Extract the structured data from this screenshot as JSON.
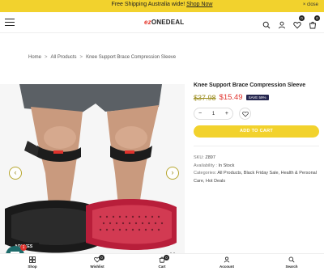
{
  "announcement": {
    "text": "Free Shipping Australia wide! ",
    "link": "Shop Now",
    "close": "× close"
  },
  "header": {
    "logo_part1": "ez",
    "logo_part2": "ONEDEAL",
    "wishlist_count": "0",
    "cart_count": "0"
  },
  "breadcrumb": {
    "home": "Home",
    "all_products": "All Products",
    "current": "Knee Support Brace Compression Sleeve"
  },
  "gallery": {
    "prev": "‹",
    "next": "›",
    "strap_brand": "AOLIKES"
  },
  "product": {
    "title": "Knee Support Brace Compression Sleeve",
    "old_price": "$37.98",
    "new_price": "$15.49",
    "save_badge": "SAVE 59%",
    "quantity": "1",
    "minus": "−",
    "plus": "+",
    "add_to_cart": "ADD TO CART",
    "sku_label": "SKU:",
    "sku": "Z897",
    "availability_label": "Availability :",
    "availability": "In Stock",
    "categories_label": "Categories:",
    "categories": "All Products, Black Friday Sale, Health & Personal Care, Hot Deals"
  },
  "bottom_nav": {
    "shop": "Shop",
    "wishlist": "Wishlist",
    "wishlist_count": "0",
    "cart": "Cart",
    "cart_count": "0",
    "account": "Account",
    "search": "Search"
  },
  "chat": {
    "badge": "1"
  },
  "colors": {
    "accent": "#f2d22d",
    "sale_red": "#e0322c",
    "old_price": "#9a8b1c",
    "badge_navy": "#25264f"
  }
}
